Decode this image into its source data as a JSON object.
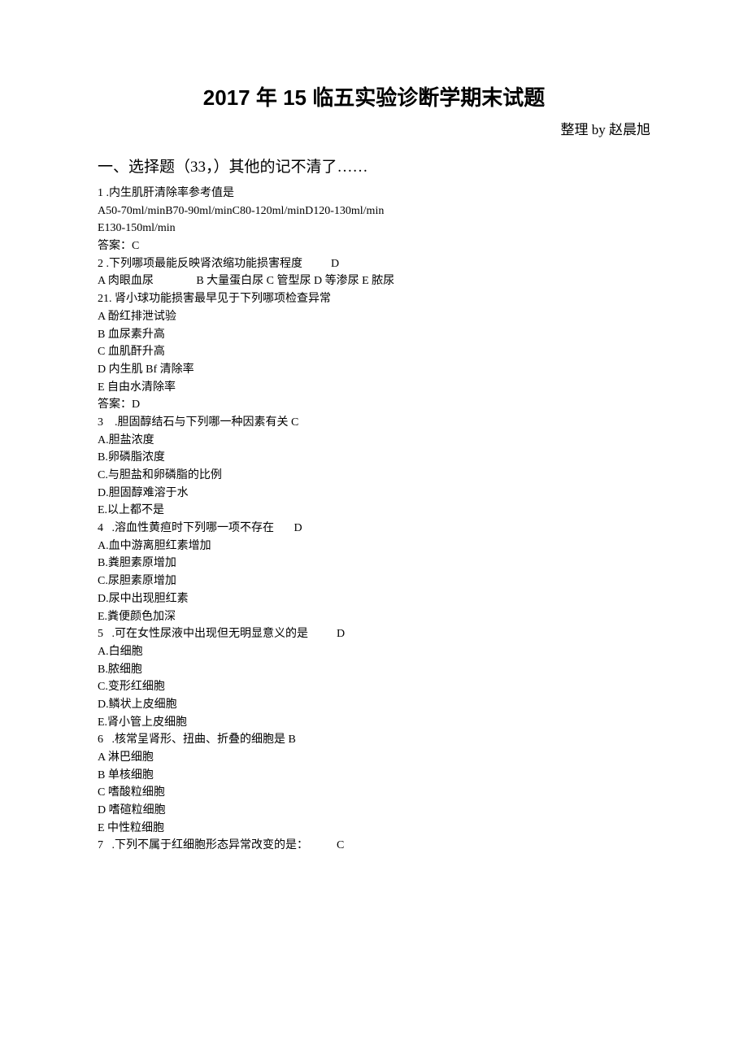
{
  "title": "2017 年 15 临五实验诊断学期末试题",
  "byline": "整理 by 赵晨旭",
  "section_heading": "一、选择题（33，）其他的记不清了……",
  "lines": [
    "1 .内生肌肝清除率参考值是",
    "A50-70ml/minB70-90ml/minC80-120ml/minD120-130ml/min",
    "E130-150ml/min",
    "答案：C",
    "2 .下列哪项最能反映肾浓缩功能损害程度          D",
    "A 肉眼血尿               B 大量蛋白尿 C 管型尿 D 等渗尿 E 脓尿",
    "21. 肾小球功能损害最早见于下列哪项检查异常",
    "A 酚红排泄试验",
    "B 血尿素升高",
    "C 血肌酐升高",
    "D 内生肌 Bf 清除率",
    "E 自由水清除率",
    "答案：D",
    "3    .胆固醇结石与下列哪一种因素有关 C",
    "A.胆盐浓度",
    "B.卵磷脂浓度",
    "C.与胆盐和卵磷脂的比例",
    "D.胆固醇难溶于水",
    "E.以上都不是",
    "4   .溶血性黄疸时下列哪一项不存在       D",
    "A.血中游离胆红素增加",
    "B.粪胆素原增加",
    "C.尿胆素原增加",
    "D.尿中出现胆红素",
    "E.粪便颜色加深",
    "5   .可在女性尿液中出现但无明显意义的是          D",
    "A.白细胞",
    "B.脓细胞",
    "C.变形红细胞",
    "D.鳞状上皮细胞",
    "E.肾小管上皮细胞",
    "6   .核常呈肾形、扭曲、折叠的细胞是 B",
    "A 淋巴细胞",
    "B 单核细胞",
    "C 嗜酸粒细胞",
    "D 嗜碹粒细胞",
    "E 中性粒细胞",
    "7   .下列不属于红细胞形态异常改变的是：          C"
  ]
}
